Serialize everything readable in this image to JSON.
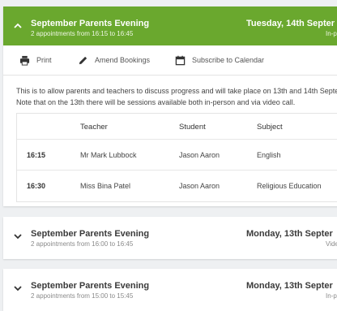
{
  "appointments": [
    {
      "title": "September Parents Evening",
      "subtitle": "2 appointments from 16:15 to 16:45",
      "date": "Tuesday, 14th Septer",
      "mode": "In-p",
      "expanded": true
    },
    {
      "title": "September Parents Evening",
      "subtitle": "2 appointments from 16:00 to 16:45",
      "date": "Monday, 13th Septer",
      "mode": "Vide",
      "expanded": false
    },
    {
      "title": "September Parents Evening",
      "subtitle": "2 appointments from 15:00 to 15:45",
      "date": "Monday, 13th Septer",
      "mode": "In-p",
      "expanded": false
    }
  ],
  "toolbar": {
    "print_label": "Print",
    "amend_label": "Amend Bookings",
    "subscribe_label": "Subscribe to Calendar"
  },
  "description": {
    "line1": "This is to allow parents and teachers to discuss progress and will take place on 13th and 14th Septen",
    "line2": "Note that on the 13th there will be sessions available both in-person and via video call."
  },
  "table": {
    "headers": {
      "time": "",
      "teacher": "Teacher",
      "student": "Student",
      "subject": "Subject"
    },
    "rows": [
      {
        "time": "16:15",
        "teacher": "Mr Mark Lubbock",
        "student": "Jason Aaron",
        "subject": "English"
      },
      {
        "time": "16:30",
        "teacher": "Miss Bina Patel",
        "student": "Jason Aaron",
        "subject": "Religious Education"
      }
    ]
  },
  "colors": {
    "accent": "#6aa82e",
    "background": "#eef0f2"
  },
  "icons": {
    "expanded": "chevron-up-icon",
    "collapsed": "chevron-down-icon",
    "print": "printer-icon",
    "amend": "pencil-icon",
    "subscribe": "calendar-icon"
  }
}
